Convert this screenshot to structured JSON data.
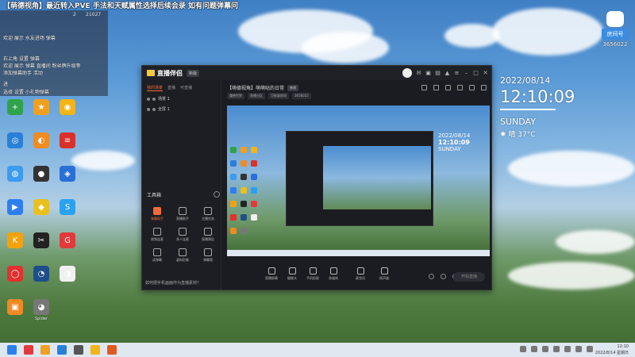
{
  "banner": {
    "title": "【萌德视角】最近转入PVE 手法和天赋属性选择后续会录 如有问题弹幕问"
  },
  "chat": {
    "stat_likes": "2",
    "stat_count": "21027",
    "lines": [
      "欢迎 展示 水友进场 弹幕",
      "右上角 设置 弹幕",
      "欢迎 展示 弹幕 直播间 粉丝牌升级等",
      "添加弹幕助手 活动",
      "进",
      "选择 设置 小礼物弹幕"
    ]
  },
  "stream": {
    "badge_label": "房间号",
    "room_number": "3656022"
  },
  "clock": {
    "date": "2022/08/14",
    "time": "12:10:09",
    "day": "SUNDAY",
    "weather_icon": "sun-icon",
    "weather": "晴 37°C"
  },
  "desktop_icons": [
    {
      "label": "",
      "color": "#2fa34b",
      "glyph": "+"
    },
    {
      "label": "",
      "color": "#f0a020",
      "glyph": "★"
    },
    {
      "label": "",
      "color": "#f2b416",
      "glyph": "◉"
    },
    {
      "label": "",
      "color": "#2a80d6",
      "glyph": "◎"
    },
    {
      "label": "",
      "color": "#f08c20",
      "glyph": "◐"
    },
    {
      "label": "",
      "color": "#d9302a",
      "glyph": "≡"
    },
    {
      "label": "",
      "color": "#3b9cf0",
      "glyph": "◍"
    },
    {
      "label": "",
      "color": "#333333",
      "glyph": "●"
    },
    {
      "label": "",
      "color": "#2a6fd6",
      "glyph": "◈"
    },
    {
      "label": "",
      "color": "#2d7ff0",
      "glyph": "▶"
    },
    {
      "label": "",
      "color": "#e8c020",
      "glyph": "◆"
    },
    {
      "label": "",
      "color": "#2aa2f0",
      "glyph": "S"
    },
    {
      "label": "",
      "color": "#f2a20c",
      "glyph": "K"
    },
    {
      "label": "",
      "color": "#222222",
      "glyph": "✂"
    },
    {
      "label": "",
      "color": "#e23a3a",
      "glyph": "G"
    },
    {
      "label": "",
      "color": "#e23030",
      "glyph": "◯"
    },
    {
      "label": "",
      "color": "#1e4f8a",
      "glyph": "◔"
    },
    {
      "label": "",
      "color": "#f0f0f0",
      "glyph": "◑"
    },
    {
      "label": "",
      "color": "#f08a24",
      "glyph": "▣"
    },
    {
      "label": "Spider",
      "color": "#777777",
      "glyph": "◕"
    }
  ],
  "app": {
    "name": "直播伴侣",
    "version_badge": "新版",
    "left_tabs": [
      "我的场景",
      "直播",
      "可直播"
    ],
    "scenes": [
      "场景 1",
      "全屏 1"
    ],
    "tools_heading": "工具箱",
    "tools": [
      {
        "label": "弹幕助手",
        "hot": true
      },
      {
        "label": "直播助手",
        "hot": false
      },
      {
        "label": "主播任务",
        "hot": false
      },
      {
        "label": "视频连麦",
        "hot": false
      },
      {
        "label": "多人连麦",
        "hot": false
      },
      {
        "label": "直播预告",
        "hot": false
      },
      {
        "label": "读弹幕",
        "hot": false
      },
      {
        "label": "虚拟形象",
        "hot": false
      },
      {
        "label": "弹幕墙",
        "hot": false
      }
    ],
    "room_title": "【萌德视角】萌萌哒的日常",
    "room_edit": "修改",
    "room_tags": [
      "魔兽世界",
      "直播分区",
      "可恢复房间",
      "3656022"
    ],
    "bottom_items": [
      "直播屏幕",
      "摄像头",
      "手机投屏",
      "多媒体",
      "麦克风",
      "扬声器"
    ],
    "start_label": "开始直播",
    "status_text": "如何把手机画面作为直播素材？"
  },
  "preview": {
    "inner_date": "2022/08/14",
    "inner_time": "12:10:09",
    "inner_day": "SUNDAY"
  },
  "taskbar": {
    "time": "12:10",
    "date": "2022/8/14 星期日"
  }
}
